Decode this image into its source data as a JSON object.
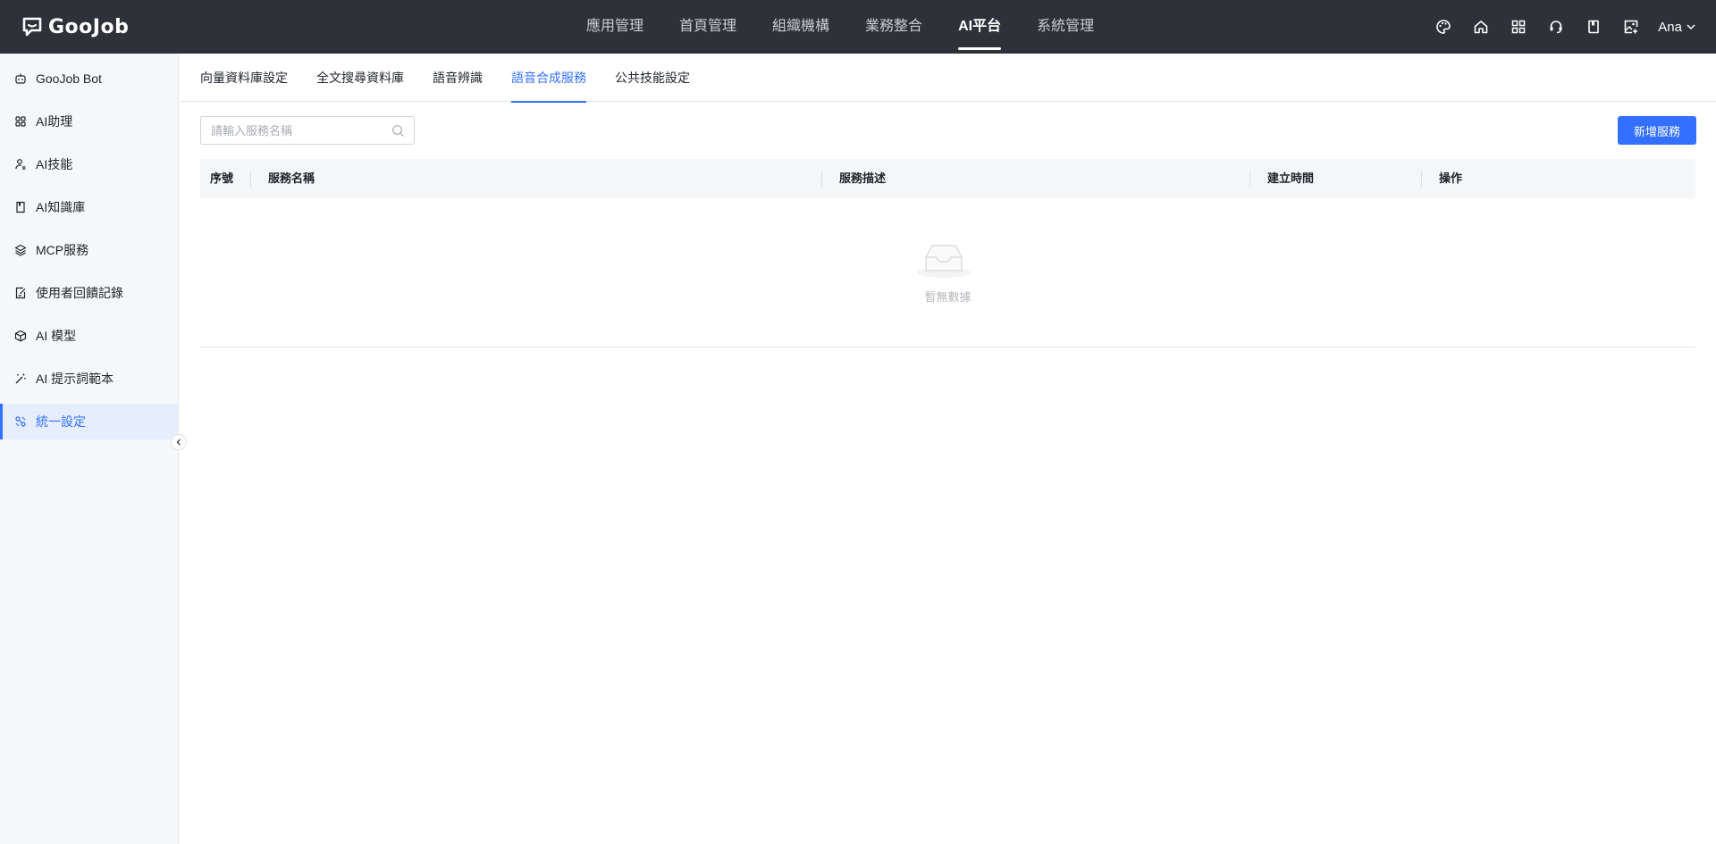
{
  "brand": {
    "logo_text": "GooJob"
  },
  "topnav": {
    "items": [
      {
        "label": "應用管理"
      },
      {
        "label": "首頁管理"
      },
      {
        "label": "組織機構"
      },
      {
        "label": "業務整合"
      },
      {
        "label": "AI平台",
        "active": true
      },
      {
        "label": "系統管理"
      }
    ],
    "icons": [
      "palette-icon",
      "home-icon",
      "apps-grid-icon",
      "support-icon",
      "book-icon",
      "image-add-icon"
    ],
    "user_name": "Ana"
  },
  "sidebar": {
    "items": [
      {
        "label": "GooJob Bot",
        "icon": "robot-icon"
      },
      {
        "label": "AI助理",
        "icon": "grid-icon"
      },
      {
        "label": "AI技能",
        "icon": "skill-icon"
      },
      {
        "label": "AI知識庫",
        "icon": "book-icon"
      },
      {
        "label": "MCP服務",
        "icon": "layers-icon"
      },
      {
        "label": "使用者回饋記錄",
        "icon": "feedback-icon"
      },
      {
        "label": "AI 模型",
        "icon": "cube-icon"
      },
      {
        "label": "AI 提示詞範本",
        "icon": "wand-icon"
      },
      {
        "label": "統一設定",
        "icon": "settings-icon",
        "active": true
      }
    ]
  },
  "tabs": [
    {
      "label": "向量資料庫設定"
    },
    {
      "label": "全文搜尋資料庫"
    },
    {
      "label": "語音辨識"
    },
    {
      "label": "語音合成服務",
      "active": true
    },
    {
      "label": "公共技能設定"
    }
  ],
  "search": {
    "placeholder": "請輸入服務名稱",
    "value": ""
  },
  "actions": {
    "add_label": "新增服務"
  },
  "table": {
    "columns": [
      "序號",
      "服務名稱",
      "服務描述",
      "建立時間",
      "操作"
    ],
    "rows": [],
    "empty_text": "暫無數據"
  },
  "colors": {
    "topbar": "#2e3138",
    "accent": "#3370ff",
    "sidebar_bg": "#f6f7f9"
  }
}
